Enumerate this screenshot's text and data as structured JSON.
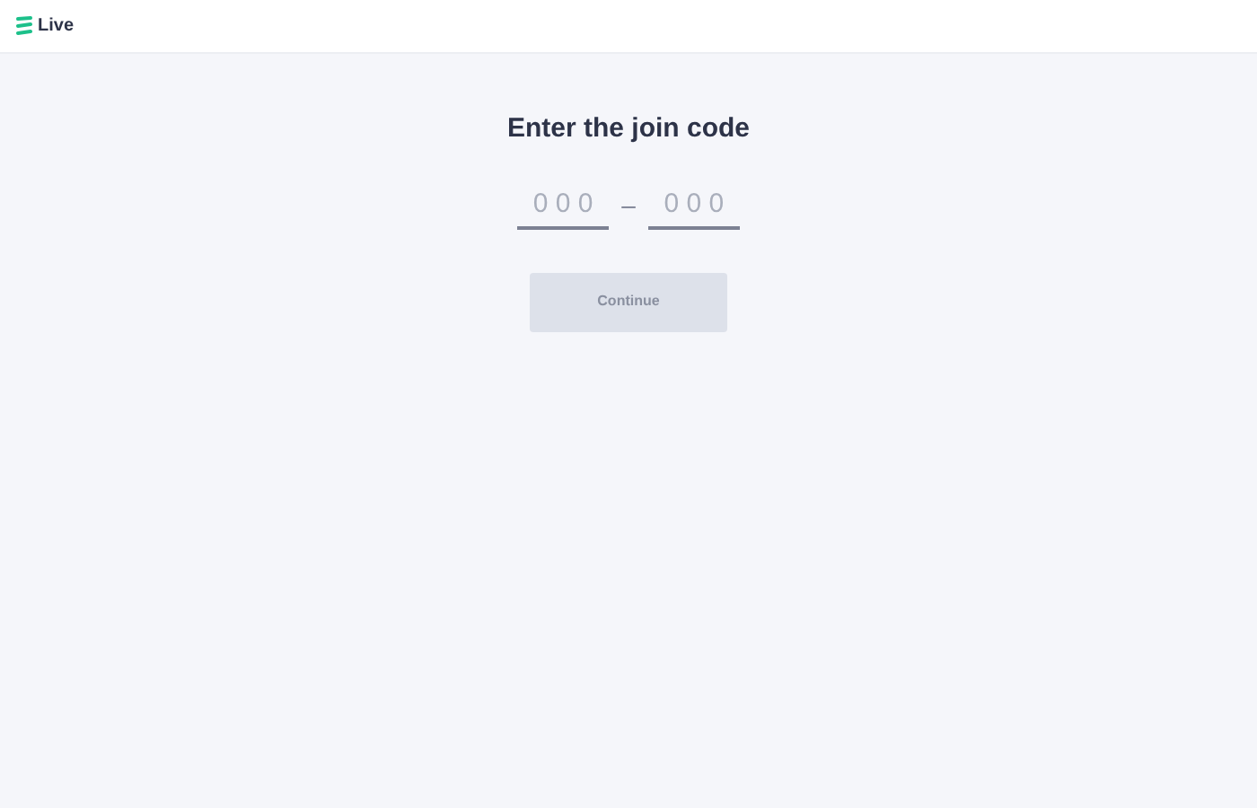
{
  "header": {
    "brand": "Live"
  },
  "title": "Enter the join code",
  "code_fields": [
    {
      "placeholder": "0 0 0"
    },
    {
      "placeholder": "0 0 0"
    }
  ],
  "separator": "–",
  "continue_button": {
    "label": "Continue",
    "disabled": true
  }
}
